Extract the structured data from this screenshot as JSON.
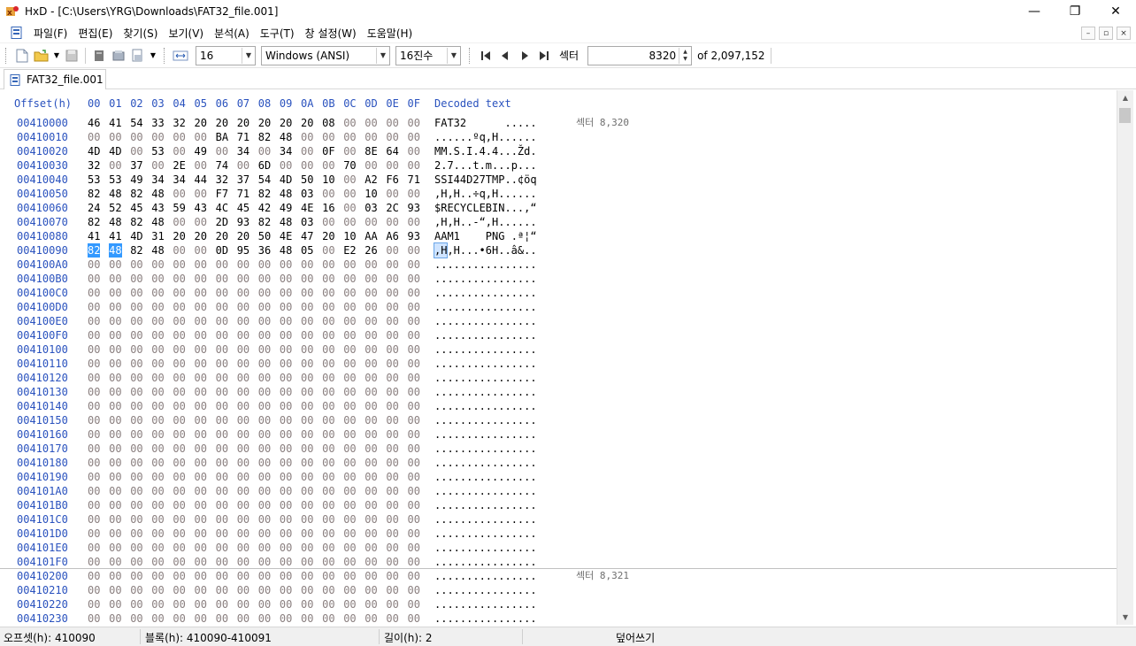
{
  "window": {
    "title": "HxD - [C:\\Users\\YRG\\Downloads\\FAT32_file.001]",
    "controls": {
      "minimize": "—",
      "restore": "❐",
      "close": "✕"
    }
  },
  "menu": {
    "items": [
      "파일(F)",
      "편집(E)",
      "찾기(S)",
      "보기(V)",
      "분석(A)",
      "도구(T)",
      "창 설정(W)",
      "도움말(H)"
    ],
    "mdi_controls": {
      "minimize": "–",
      "restore": "▫",
      "close": "×"
    }
  },
  "toolbar": {
    "bytes_per_row": "16",
    "charset": "Windows (ANSI)",
    "offset_base": "16진수",
    "sector_label": "섹터",
    "sector_value": "8320",
    "sector_total": "of 2,097,152"
  },
  "tab": {
    "label": "FAT32_file.001"
  },
  "hex": {
    "header": {
      "offset": "Offset(h)",
      "columns": [
        "00",
        "01",
        "02",
        "03",
        "04",
        "05",
        "06",
        "07",
        "08",
        "09",
        "0A",
        "0B",
        "0C",
        "0D",
        "0E",
        "0F"
      ],
      "decoded": "Decoded text"
    },
    "rows": [
      {
        "offset": "00410000",
        "bytes": [
          "46",
          "41",
          "54",
          "33",
          "32",
          "20",
          "20",
          "20",
          "20",
          "20",
          "20",
          "08",
          "00",
          "00",
          "00",
          "00"
        ],
        "text": "FAT32      .....",
        "sector": "섹터 8,320"
      },
      {
        "offset": "00410010",
        "bytes": [
          "00",
          "00",
          "00",
          "00",
          "00",
          "00",
          "BA",
          "71",
          "82",
          "48",
          "00",
          "00",
          "00",
          "00",
          "00",
          "00"
        ],
        "text": "......ºq,H......"
      },
      {
        "offset": "00410020",
        "bytes": [
          "4D",
          "4D",
          "00",
          "53",
          "00",
          "49",
          "00",
          "34",
          "00",
          "34",
          "00",
          "0F",
          "00",
          "8E",
          "64",
          "00"
        ],
        "text": "MM.S.I.4.4...Žd."
      },
      {
        "offset": "00410030",
        "bytes": [
          "32",
          "00",
          "37",
          "00",
          "2E",
          "00",
          "74",
          "00",
          "6D",
          "00",
          "00",
          "00",
          "70",
          "00",
          "00",
          "00"
        ],
        "text": "2.7...t.m...p..."
      },
      {
        "offset": "00410040",
        "bytes": [
          "53",
          "53",
          "49",
          "34",
          "34",
          "44",
          "32",
          "37",
          "54",
          "4D",
          "50",
          "10",
          "00",
          "A2",
          "F6",
          "71"
        ],
        "text": "SSI44D27TMP..¢öq"
      },
      {
        "offset": "00410050",
        "bytes": [
          "82",
          "48",
          "82",
          "48",
          "00",
          "00",
          "F7",
          "71",
          "82",
          "48",
          "03",
          "00",
          "00",
          "10",
          "00",
          "00"
        ],
        "text": ",H,H..÷q,H......"
      },
      {
        "offset": "00410060",
        "bytes": [
          "24",
          "52",
          "45",
          "43",
          "59",
          "43",
          "4C",
          "45",
          "42",
          "49",
          "4E",
          "16",
          "00",
          "03",
          "2C",
          "93"
        ],
        "text": "$RECYCLEBIN...,“"
      },
      {
        "offset": "00410070",
        "bytes": [
          "82",
          "48",
          "82",
          "48",
          "00",
          "00",
          "2D",
          "93",
          "82",
          "48",
          "03",
          "00",
          "00",
          "00",
          "00",
          "00"
        ],
        "text": ",H,H..-“,H......"
      },
      {
        "offset": "00410080",
        "bytes": [
          "41",
          "41",
          "4D",
          "31",
          "20",
          "20",
          "20",
          "20",
          "50",
          "4E",
          "47",
          "20",
          "10",
          "AA",
          "A6",
          "93"
        ],
        "text": "AAM1    PNG .ª¦“"
      },
      {
        "offset": "00410090",
        "bytes": [
          "82",
          "48",
          "82",
          "48",
          "00",
          "00",
          "0D",
          "95",
          "36",
          "48",
          "05",
          "00",
          "E2",
          "26",
          "00",
          "00"
        ],
        "text": ",H,H...•6H..â&..",
        "sel_bytes": [
          0,
          1
        ],
        "sel_text": ",H",
        "text_rest": ",H...•6H..â&.."
      },
      {
        "offset": "004100A0",
        "zero": true,
        "text": "................"
      },
      {
        "offset": "004100B0",
        "zero": true,
        "text": "................"
      },
      {
        "offset": "004100C0",
        "zero": true,
        "text": "................"
      },
      {
        "offset": "004100D0",
        "zero": true,
        "text": "................"
      },
      {
        "offset": "004100E0",
        "zero": true,
        "text": "................"
      },
      {
        "offset": "004100F0",
        "zero": true,
        "text": "................"
      },
      {
        "offset": "00410100",
        "zero": true,
        "text": "................"
      },
      {
        "offset": "00410110",
        "zero": true,
        "text": "................"
      },
      {
        "offset": "00410120",
        "zero": true,
        "text": "................"
      },
      {
        "offset": "00410130",
        "zero": true,
        "text": "................"
      },
      {
        "offset": "00410140",
        "zero": true,
        "text": "................"
      },
      {
        "offset": "00410150",
        "zero": true,
        "text": "................"
      },
      {
        "offset": "00410160",
        "zero": true,
        "text": "................"
      },
      {
        "offset": "00410170",
        "zero": true,
        "text": "................"
      },
      {
        "offset": "00410180",
        "zero": true,
        "text": "................"
      },
      {
        "offset": "00410190",
        "zero": true,
        "text": "................"
      },
      {
        "offset": "004101A0",
        "zero": true,
        "text": "................"
      },
      {
        "offset": "004101B0",
        "zero": true,
        "text": "................"
      },
      {
        "offset": "004101C0",
        "zero": true,
        "text": "................"
      },
      {
        "offset": "004101D0",
        "zero": true,
        "text": "................"
      },
      {
        "offset": "004101E0",
        "zero": true,
        "text": "................"
      },
      {
        "offset": "004101F0",
        "zero": true,
        "text": "................"
      },
      {
        "offset": "00410200",
        "zero": true,
        "text": "................",
        "sector": "섹터 8,321"
      },
      {
        "offset": "00410210",
        "zero": true,
        "text": "................"
      },
      {
        "offset": "00410220",
        "zero": true,
        "text": "................"
      },
      {
        "offset": "00410230",
        "zero": true,
        "text": "................"
      }
    ]
  },
  "status": {
    "offset": "오프셋(h): 410090",
    "block": "블록(h): 410090-410091",
    "length": "길이(h): 2",
    "mode": "덮어쓰기"
  },
  "colors": {
    "offset_blue": "#2a52be",
    "selection": "#3399ff",
    "zero_byte": "#8a7f7f"
  }
}
